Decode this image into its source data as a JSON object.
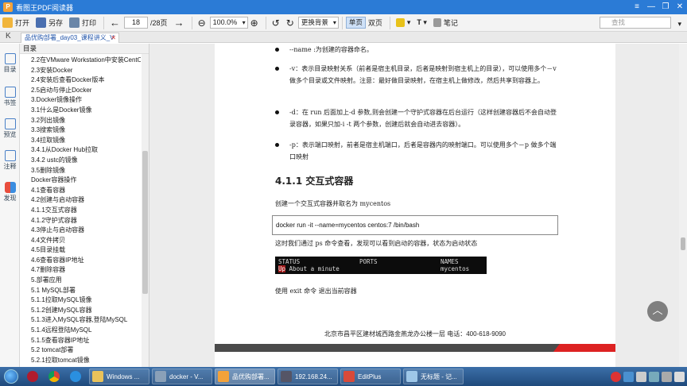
{
  "window": {
    "title": "看图王PDF阅读器",
    "controls": [
      "≡",
      "—",
      "❐",
      "✕"
    ]
  },
  "toolbar": {
    "open": "打开",
    "saveas": "另存",
    "print": "打印",
    "page_current": "18",
    "page_total": "/28页",
    "zoom": "100.0%",
    "bg_button": "更换背景",
    "single_page": "单页",
    "double_page": "双页",
    "notes": "笔记",
    "search_placeholder": "查找"
  },
  "tab": {
    "label": "品优购部署_day03_课程讲义_V"
  },
  "rail": {
    "items": [
      "目录",
      "书签",
      "预览",
      "注释",
      "发现"
    ]
  },
  "outline": {
    "header": "目录",
    "items": [
      "2.2在VMware Workstation中安装CentO",
      "2.3安装Docker",
      "2.4安装后查看Docker版本",
      "2.5启动与停止Docker",
      "3.Docker镜像操作",
      "3.1什么是Docker镜像",
      "3.2列出镜像",
      "3.3搜索镜像",
      "3.4拉取镜像",
      "3.4.1从Docker Hub拉取",
      "3.4.2 ustc的镜像",
      "3.5删除镜像",
      "Docker容器操作",
      "4.1查看容器",
      "4.2创建与启动容器",
      "4.1.1交互式容器",
      "4.1.2守护式容器",
      "4.3停止与启动容器",
      "4.4文件拷贝",
      "4.5目录挂载",
      "4.6查看容器IP地址",
      "4.7删除容器",
      "5.部署应用",
      "5.1 MySQL部署",
      "5.1.1拉取MySQL镜像",
      "5.1.2创建MySQL容器",
      "5.1.3进入MySQL容器,登陆MySQL",
      "5.1.4远程登陆MySQL",
      "5.1.5查看容器IP地址",
      "5.2 tomcat部署",
      "5.2.1拉取tomcat镜像"
    ]
  },
  "doc": {
    "bullets": [
      "--name :为创建的容器命名。",
      "-v：表示目录映射关系（前者是宿主机目录，后者是映射到宿主机上的目录），可以使用多个－v 做多个目录或文件映射。注意：最好做目录映射，在宿主机上做修改，然后共享到容器上。",
      "-d：在 run 后面加上-d 参数,则会创建一个守护式容器在后台运行（这样创建容器后不会自动登录容器，如果只加-i -t 两个参数，创建后就会自动进去容器）。",
      "-p：表示端口映射，前者是宿主机端口，后者是容器内的映射端口。可以使用多个－p 做多个端口映射"
    ],
    "heading": "4.1.1 交互式容器",
    "intro": "创建一个交互式容器并取名为 mycentos",
    "command": "docker run -it --name=mycentos centos:7 /bin/bash",
    "after_cmd": "这时我们通过 ps 命令查看，发现可以看到启动的容器，状态为启动状态",
    "terminal": {
      "col_status": "STATUS",
      "col_ports": "PORTS",
      "col_names": "NAMES",
      "status_up": "Up",
      "status_rest": " About a minute",
      "name": "mycentos"
    },
    "exit_text": "使用 exit 命令 退出当前容器",
    "footer": "北京市昌平区建材城西路金燕龙办公楼一层     电话：400-618-9090"
  },
  "taskbar": {
    "apps": [
      "Windows ...",
      "docker - V...",
      "品优购部署...",
      "192.168.24...",
      "EditPlus",
      "无标题 - 记..."
    ]
  },
  "colors": {
    "titlebar": "#2b7bd6",
    "accent_red": "#d22222"
  }
}
